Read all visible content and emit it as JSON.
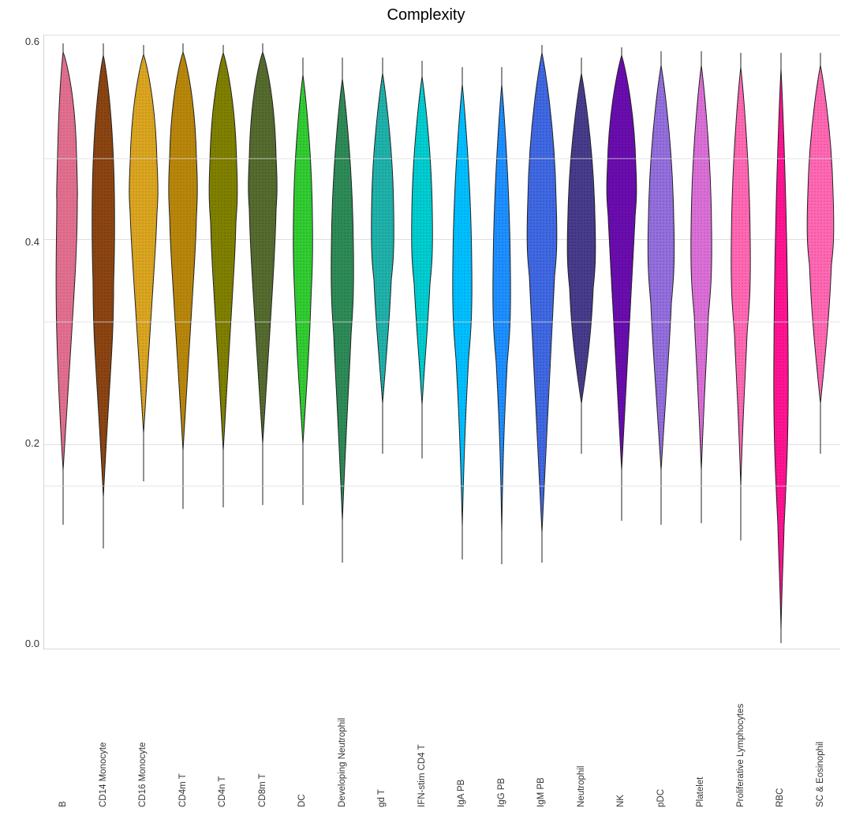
{
  "title": "Complexity",
  "yAxis": {
    "ticks": [
      "0.0",
      "0.2",
      "0.4",
      "0.6"
    ]
  },
  "violins": [
    {
      "id": "B",
      "label": "B",
      "color": "#E07090",
      "x": 0
    },
    {
      "id": "CD14Monocyte",
      "label": "CD14 Monocyte",
      "color": "#8B4513",
      "x": 1
    },
    {
      "id": "CD16Monocyte",
      "label": "CD16 Monocyte",
      "color": "#DAA520",
      "x": 2
    },
    {
      "id": "CD4mT",
      "label": "CD4m T",
      "color": "#B8860B",
      "x": 3
    },
    {
      "id": "CD4nT",
      "label": "CD4n T",
      "color": "#808000",
      "x": 4
    },
    {
      "id": "CD8mT",
      "label": "CD8m T",
      "color": "#556B2F",
      "x": 5
    },
    {
      "id": "DC",
      "label": "DC",
      "color": "#32CD32",
      "x": 6
    },
    {
      "id": "DevelopingNeutrophil",
      "label": "Developing Neutrophil",
      "color": "#2E8B57",
      "x": 7
    },
    {
      "id": "gdT",
      "label": "gd T",
      "color": "#20B2AA",
      "x": 8
    },
    {
      "id": "IFNstimCD4T",
      "label": "IFN-stim CD4 T",
      "color": "#00CED1",
      "x": 9
    },
    {
      "id": "IgAPB",
      "label": "IgA PB",
      "color": "#00BFFF",
      "x": 10
    },
    {
      "id": "IgGPB",
      "label": "IgG PB",
      "color": "#1E90FF",
      "x": 11
    },
    {
      "id": "IgMPB",
      "label": "IgM PB",
      "color": "#4169E1",
      "x": 12
    },
    {
      "id": "Neutrophil",
      "label": "Neutrophil",
      "color": "#483D8B",
      "x": 13
    },
    {
      "id": "NK",
      "label": "NK",
      "color": "#6A0DAD",
      "x": 14
    },
    {
      "id": "pDC",
      "label": "pDC",
      "color": "#9370DB",
      "x": 15
    },
    {
      "id": "Platelet",
      "label": "Platelet",
      "color": "#DA70D6",
      "x": 16
    },
    {
      "id": "ProliferativeLymphocytes",
      "label": "Proliferative Lymphocytes",
      "color": "#FF69B4",
      "x": 17
    },
    {
      "id": "RBC",
      "label": "RBC",
      "color": "#FF1493",
      "x": 18
    },
    {
      "id": "SCEosinophil",
      "label": "SC & Eosinophil",
      "color": "#FF69B4",
      "x": 19
    }
  ],
  "xLabels": [
    "B",
    "CD14 Monocyte",
    "CD16 Monocyte",
    "CD4m T",
    "CD4n T",
    "CD8m T",
    "DC",
    "Developing Neutrophil",
    "gd T",
    "IFN-stim CD4 T",
    "IgA PB",
    "IgG PB",
    "IgM PB",
    "Neutrophil",
    "NK",
    "pDC",
    "Platelet",
    "Proliferative Lymphocytes",
    "RBC",
    "SC & Eosinophil"
  ]
}
